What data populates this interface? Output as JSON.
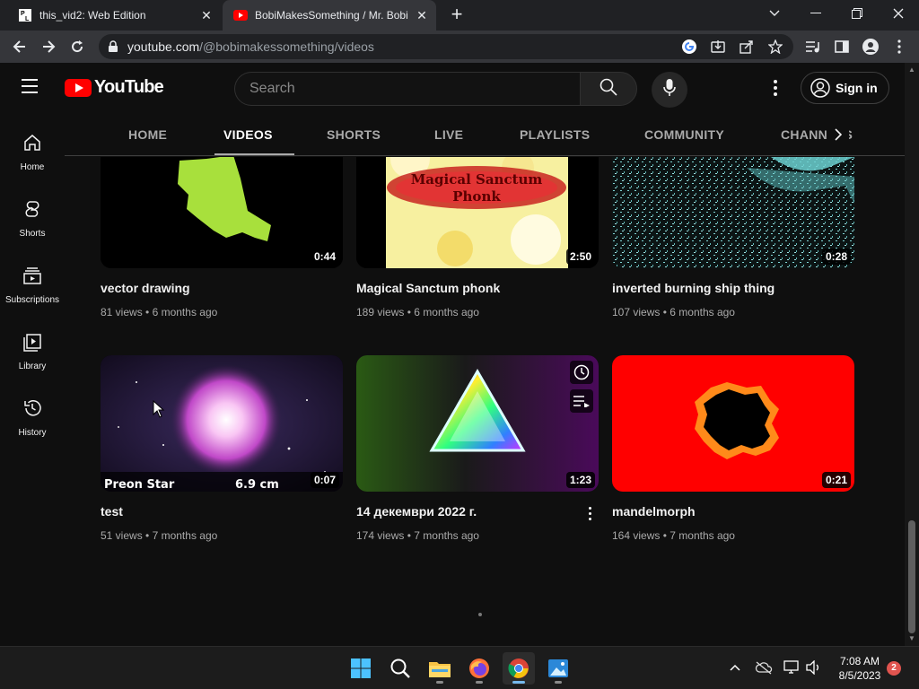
{
  "browser": {
    "tabs": [
      {
        "label": "this_vid2: Web Edition",
        "favicon": "pl-favicon",
        "active": false
      },
      {
        "label": "BobiMakesSomething / Mr. Bobi",
        "favicon": "youtube-favicon",
        "active": true
      }
    ],
    "url_host": "youtube.com",
    "url_path": "/@bobimakessomething/videos"
  },
  "youtube": {
    "logo_text": "YouTube",
    "search_placeholder": "Search",
    "signin_label": "Sign in",
    "sidebar": [
      {
        "label": "Home",
        "icon": "home-icon"
      },
      {
        "label": "Shorts",
        "icon": "shorts-icon"
      },
      {
        "label": "Subscriptions",
        "icon": "subscriptions-icon"
      },
      {
        "label": "Library",
        "icon": "library-icon"
      },
      {
        "label": "History",
        "icon": "history-icon"
      }
    ],
    "channel_tabs": [
      "HOME",
      "VIDEOS",
      "SHORTS",
      "LIVE",
      "PLAYLISTS",
      "COMMUNITY",
      "CHANNELS"
    ],
    "selected_tab": "VIDEOS",
    "videos": [
      {
        "title": "vector drawing",
        "views": "81 views",
        "age": "6 months ago",
        "duration": "0:44"
      },
      {
        "title": "Magical Sanctum phonk",
        "views": "189 views",
        "age": "6 months ago",
        "duration": "2:50",
        "thumb_text_line1": "Magical Sanctum",
        "thumb_text_line2": "Phonk"
      },
      {
        "title": "inverted burning ship thing",
        "views": "107 views",
        "age": "6 months ago",
        "duration": "0:28"
      },
      {
        "title": "test",
        "views": "51 views",
        "age": "7 months ago",
        "duration": "0:07",
        "thumb_caption_left": "Preon Star",
        "thumb_caption_right": "6.9 cm"
      },
      {
        "title": "14 декември 2022 г.",
        "views": "174 views",
        "age": "7 months ago",
        "duration": "1:23"
      },
      {
        "title": "mandelmorph",
        "views": "164 views",
        "age": "7 months ago",
        "duration": "0:21"
      }
    ],
    "meta_separator": "•"
  },
  "taskbar": {
    "apps": [
      "windows-start-icon",
      "search-icon",
      "file-explorer-icon",
      "firefox-icon",
      "chrome-icon",
      "photos-icon"
    ],
    "active_app": "chrome-icon",
    "time": "7:08 AM",
    "date": "8/5/2023",
    "notification_count": "2"
  },
  "colors": {
    "yt_red": "#ff0000",
    "background": "#0f0f0f",
    "accent_blue": "#76b9ed"
  }
}
